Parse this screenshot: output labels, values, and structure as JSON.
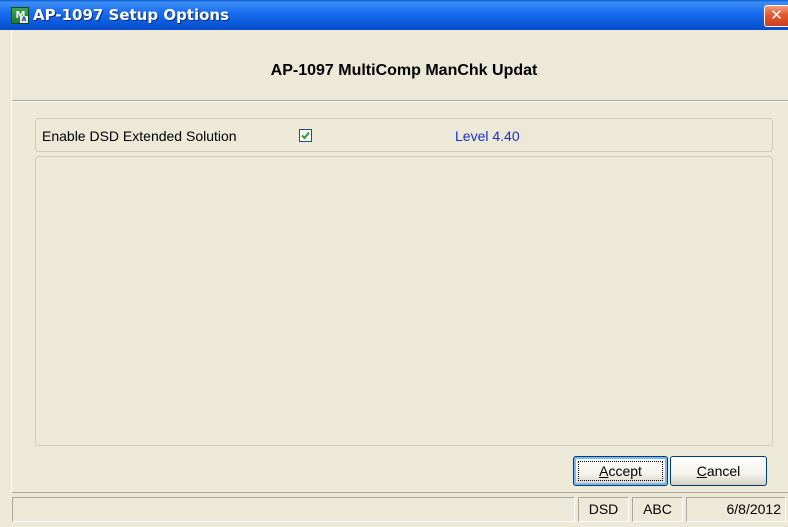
{
  "window": {
    "title": "AP-1097 Setup Options",
    "icon_label": "M",
    "icon_sub_label": "A",
    "close_glyph": "✕"
  },
  "header": {
    "title": "AP-1097 MultiComp ManChk Updat"
  },
  "options": {
    "enable_label": "Enable DSD Extended Solution",
    "enable_checked": true,
    "level_text": "Level  4.40"
  },
  "buttons": {
    "accept_label": "ccept",
    "accept_accel": "A",
    "cancel_label": "ancel",
    "cancel_accel": "C"
  },
  "status_bar": {
    "main": "",
    "company": "DSD",
    "user": "ABC",
    "date": "6/8/2012"
  },
  "colors": {
    "titlebar": "#0854d6",
    "level_text": "#1a2fcc",
    "checkmark": "#21a121",
    "close_button": "#e2582f"
  },
  "icons": {
    "app": "sage-mas-icon",
    "close": "close-icon",
    "check": "checkmark-icon"
  }
}
